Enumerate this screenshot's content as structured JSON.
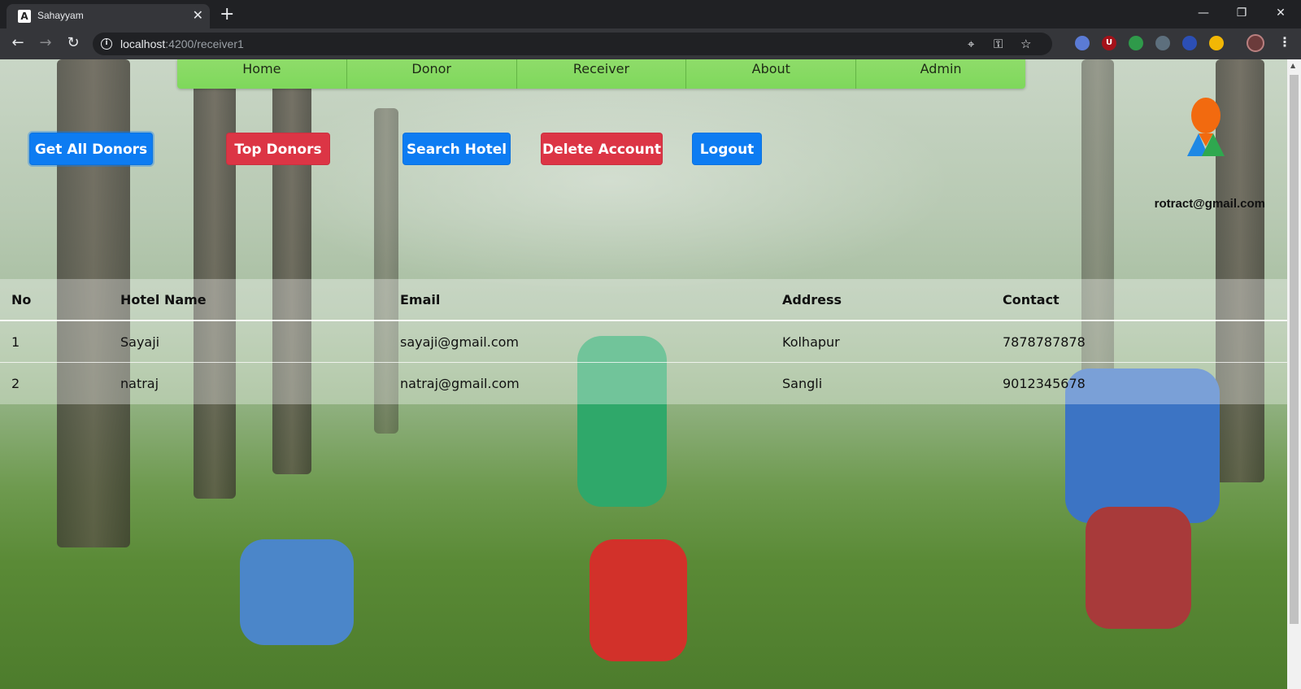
{
  "browser": {
    "tab_title": "Sahayyam",
    "tab_favicon": "A",
    "url_host": "localhost",
    "url_path": ":4200/receiver1",
    "ext_badge": "U"
  },
  "nav": {
    "items": [
      "Home",
      "Donor",
      "Receiver",
      "About",
      "Admin"
    ]
  },
  "actions": {
    "get_all_donors": "Get All Donors",
    "top_donors": "Top Donors",
    "search_hotel": "Search Hotel",
    "delete_account": "Delete Account",
    "logout": "Logout"
  },
  "user": {
    "email": "rotract@gmail.com"
  },
  "table": {
    "headers": [
      "No",
      "Hotel Name",
      "Email",
      "Address",
      "Contact"
    ],
    "rows": [
      [
        "1",
        "Sayaji",
        "sayaji@gmail.com",
        "Kolhapur",
        "7878787878"
      ],
      [
        "2",
        "natraj",
        "natraj@gmail.com",
        "Sangli",
        "9012345678"
      ]
    ]
  },
  "colors": {
    "nav_green": "#7ed85b",
    "primary_blue": "#0d7cf2",
    "danger_red": "#dc3545"
  }
}
